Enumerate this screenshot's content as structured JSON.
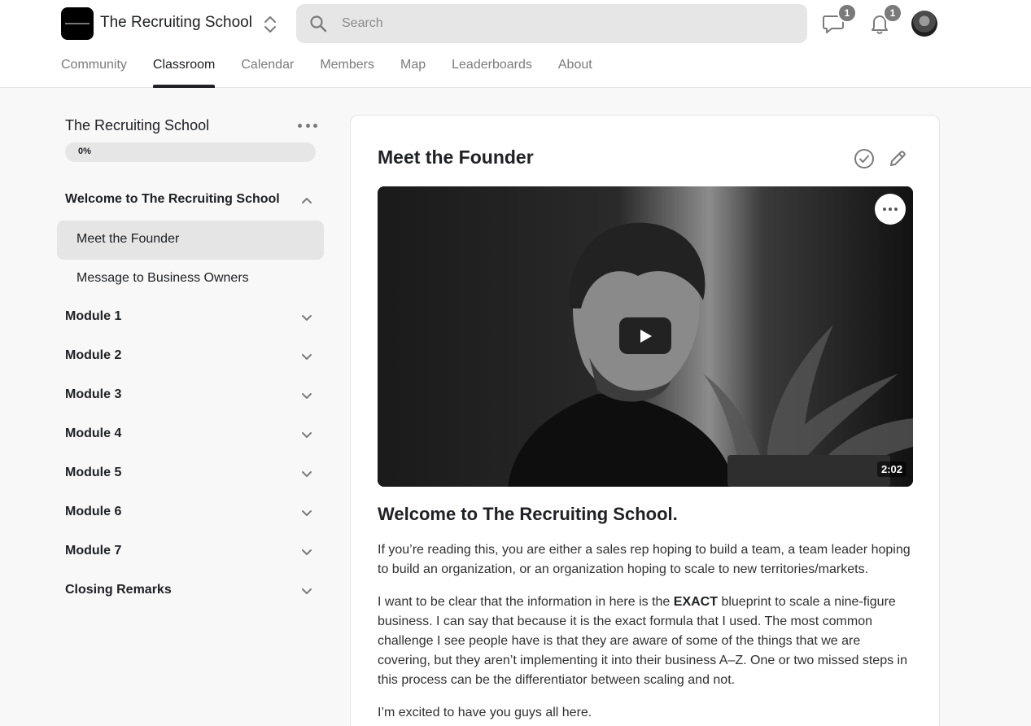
{
  "header": {
    "app_title": "The Recruiting School",
    "search_placeholder": "Search",
    "chat_badge": "1",
    "notification_badge": "1"
  },
  "tabs": [
    {
      "label": "Community",
      "active": false
    },
    {
      "label": "Classroom",
      "active": true
    },
    {
      "label": "Calendar",
      "active": false
    },
    {
      "label": "Members",
      "active": false
    },
    {
      "label": "Map",
      "active": false
    },
    {
      "label": "Leaderboards",
      "active": false
    },
    {
      "label": "About",
      "active": false
    }
  ],
  "sidebar": {
    "course_title": "The Recruiting School",
    "progress": "0%",
    "progress_value": 0,
    "sections": [
      {
        "label": "Welcome to The Recruiting School",
        "expanded": true,
        "lessons": [
          {
            "label": "Meet the Founder",
            "active": true
          },
          {
            "label": "Message to Business Owners",
            "active": false
          }
        ]
      },
      {
        "label": "Module 1",
        "expanded": false
      },
      {
        "label": "Module 2",
        "expanded": false
      },
      {
        "label": "Module 3",
        "expanded": false
      },
      {
        "label": "Module 4",
        "expanded": false
      },
      {
        "label": "Module 5",
        "expanded": false
      },
      {
        "label": "Module 6",
        "expanded": false
      },
      {
        "label": "Module 7",
        "expanded": false
      },
      {
        "label": "Closing Remarks",
        "expanded": false
      }
    ]
  },
  "lesson": {
    "title": "Meet the Founder",
    "video_duration": "2:02",
    "heading": "Welcome to The Recruiting School.",
    "paragraph_1": "If you’re reading this, you are either a sales rep hoping to build a team, a team leader hoping to build an organization, or an organization hoping to scale to new territories/markets.",
    "paragraph_2_before": "I want to be clear that the information in here is the ",
    "paragraph_2_bold": "EXACT",
    "paragraph_2_after": " blueprint to scale a nine-figure business. I can say that because it is the exact formula that I used. The most common challenge I see people have is that they are aware of some of the things that we are covering, but they aren’t implementing it into their business A–Z. One or two missed steps in this process can be the differentiator between scaling and not.",
    "paragraph_3": "I’m excited to have you guys all here."
  },
  "icons": {
    "logo": "brand-logo",
    "switcher": "chevron-up-down-icon",
    "search": "search-icon",
    "chat": "chat-bubble-icon",
    "bell": "bell-icon",
    "check": "check-circle-icon",
    "edit": "pencil-icon",
    "play": "play-icon"
  },
  "colors": {
    "accent": "#202124",
    "badge": "#7a7a7a",
    "muted_text": "#7b7b7b",
    "active_row": "#e5e5e5"
  }
}
